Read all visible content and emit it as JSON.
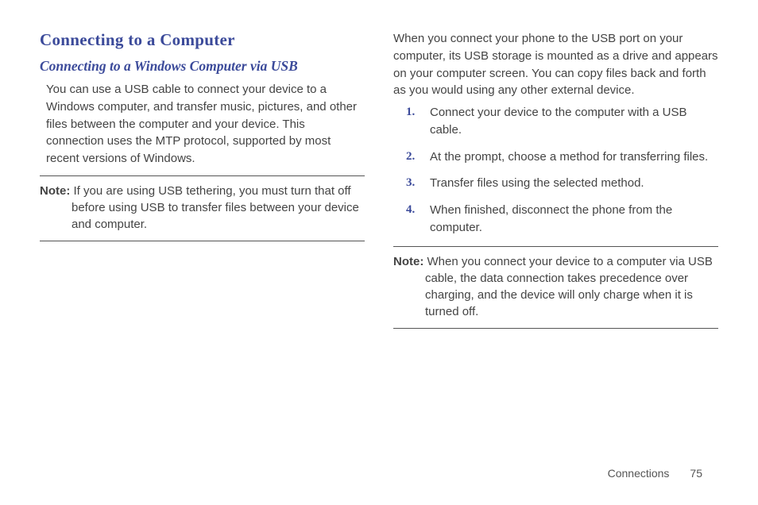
{
  "left": {
    "heading": "Connecting to a Computer",
    "subheading": "Connecting to a Windows Computer via USB",
    "intro": "You can use a USB cable to connect your device to a Windows computer, and transfer music, pictures, and other files between the computer and your device. This connection uses the MTP protocol, supported by most recent versions of Windows.",
    "note_label": "Note:",
    "note_text": " If you are using USB tethering, you must turn that off before using USB to transfer files between your device and computer."
  },
  "right": {
    "intro": "When you connect your phone to the USB port on your computer, its USB storage is mounted as a drive and appears on your computer screen. You can copy files back and forth as you would using any other external device.",
    "steps": [
      {
        "num": "1.",
        "text": "Connect your device to the computer with a USB cable."
      },
      {
        "num": "2.",
        "text": "At the prompt, choose a method for transferring files."
      },
      {
        "num": "3.",
        "text": "Transfer files using the selected method."
      },
      {
        "num": "4.",
        "text": "When finished, disconnect the phone from the computer."
      }
    ],
    "note_label": "Note:",
    "note_text": " When you connect your device to a computer via USB cable, the data connection takes precedence over charging, and the device will only charge when it is turned off."
  },
  "footer": {
    "section": "Connections",
    "page": "75"
  }
}
